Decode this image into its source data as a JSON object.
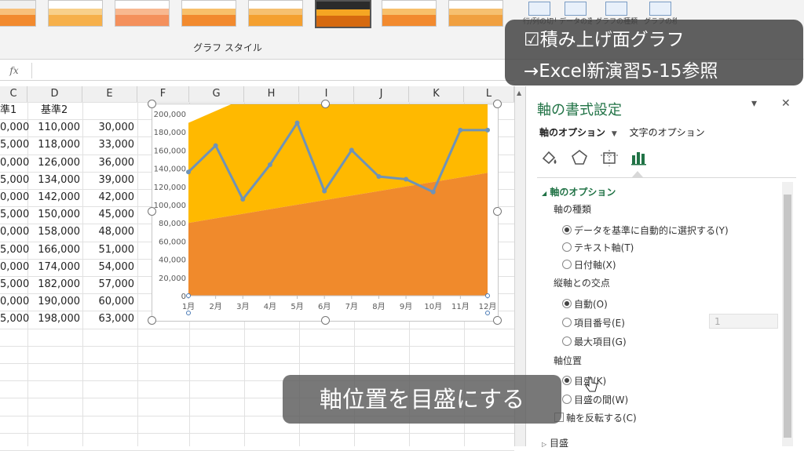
{
  "ribbon": {
    "gallery_label": "グラフ スタイル",
    "buttons": [
      "行/列の切り替え",
      "データの選択",
      "グラフの種類の変更",
      "グラフの移動"
    ],
    "styles": [
      {
        "top": "#f0f0f0",
        "mid": "#f8c07a",
        "bot": "#f28a2e"
      },
      {
        "top": "#fff",
        "mid": "#f8d08a",
        "bot": "#f6b04a"
      },
      {
        "top": "#fff",
        "mid": "#f8b890",
        "bot": "#f4905c"
      },
      {
        "top": "#fff",
        "mid": "#f8c06a",
        "bot": "#f28a2e"
      },
      {
        "top": "#fff",
        "mid": "#f6c070",
        "bot": "#f4a030"
      },
      {
        "top": "#2b2b2b",
        "mid": "#f5a623",
        "bot": "#d66a10"
      },
      {
        "top": "#fff",
        "mid": "#f8c06a",
        "bot": "#f28a2e"
      },
      {
        "top": "#fff",
        "mid": "#f6c070",
        "bot": "#f0a040"
      }
    ]
  },
  "formula_bar": {
    "fx": "fx",
    "value": ""
  },
  "columns": [
    "C",
    "D",
    "E",
    "F",
    "G",
    "H",
    "I",
    "J",
    "K",
    "L"
  ],
  "sheet": {
    "headers": [
      "準1",
      "基準2",
      ""
    ],
    "rows": [
      [
        "0,000",
        "110,000",
        "30,000"
      ],
      [
        "5,000",
        "118,000",
        "33,000"
      ],
      [
        "0,000",
        "126,000",
        "36,000"
      ],
      [
        "5,000",
        "134,000",
        "39,000"
      ],
      [
        "0,000",
        "142,000",
        "42,000"
      ],
      [
        "5,000",
        "150,000",
        "45,000"
      ],
      [
        "0,000",
        "158,000",
        "48,000"
      ],
      [
        "5,000",
        "166,000",
        "51,000"
      ],
      [
        "0,000",
        "174,000",
        "54,000"
      ],
      [
        "5,000",
        "182,000",
        "57,000"
      ],
      [
        "0,000",
        "190,000",
        "60,000"
      ],
      [
        "5,000",
        "198,000",
        "63,000"
      ]
    ]
  },
  "chart_data": {
    "type": "area",
    "categories": [
      "1月",
      "2月",
      "3月",
      "4月",
      "5月",
      "6月",
      "7月",
      "8月",
      "9月",
      "10月",
      "11月",
      "12月"
    ],
    "series": [
      {
        "type": "area",
        "color": "#f08a2c",
        "values": [
          80000,
          85000,
          90000,
          95000,
          100000,
          105000,
          110000,
          115000,
          120000,
          125000,
          130000,
          135000
        ]
      },
      {
        "type": "area",
        "color": "#ffb900",
        "values": [
          110000,
          118000,
          126000,
          134000,
          142000,
          150000,
          158000,
          166000,
          174000,
          182000,
          190000,
          198000
        ]
      },
      {
        "type": "line",
        "color": "#6f93b7",
        "values": [
          136000,
          165000,
          106000,
          144000,
          190000,
          115000,
          160000,
          131000,
          128000,
          114000,
          182000,
          182000
        ]
      }
    ],
    "yticks": [
      "0",
      "20,000",
      "40,000",
      "60,000",
      "80,000",
      "100,000",
      "120,000",
      "140,000",
      "160,000",
      "180,000",
      "200,000"
    ],
    "ylim": [
      0,
      200000
    ],
    "grid": false
  },
  "pane": {
    "title": "軸の書式設定",
    "dropdown": "▾",
    "close": "✕",
    "tab_axis": "軸のオプション",
    "tab_text": "文字のオプション",
    "section": "軸のオプション",
    "axis_type_label": "軸の種類",
    "axis_type_options": [
      "データを基準に自動的に選択する(Y)",
      "テキスト軸(T)",
      "日付軸(X)"
    ],
    "cross_label": "縦軸との交点",
    "cross_options": [
      "自動(O)",
      "項目番号(E)",
      "最大項目(G)"
    ],
    "cross_number": "1",
    "position_label": "軸位置",
    "position_options": [
      "目盛(K)",
      "目盛の間(W)"
    ],
    "reverse_label": "軸を反転する(C)",
    "next_section": "目盛"
  },
  "overlay": {
    "line1": "☑積み上げ面グラフ",
    "line2": "→Excel新演習5-15参照",
    "caption": "軸位置を目盛にする"
  }
}
